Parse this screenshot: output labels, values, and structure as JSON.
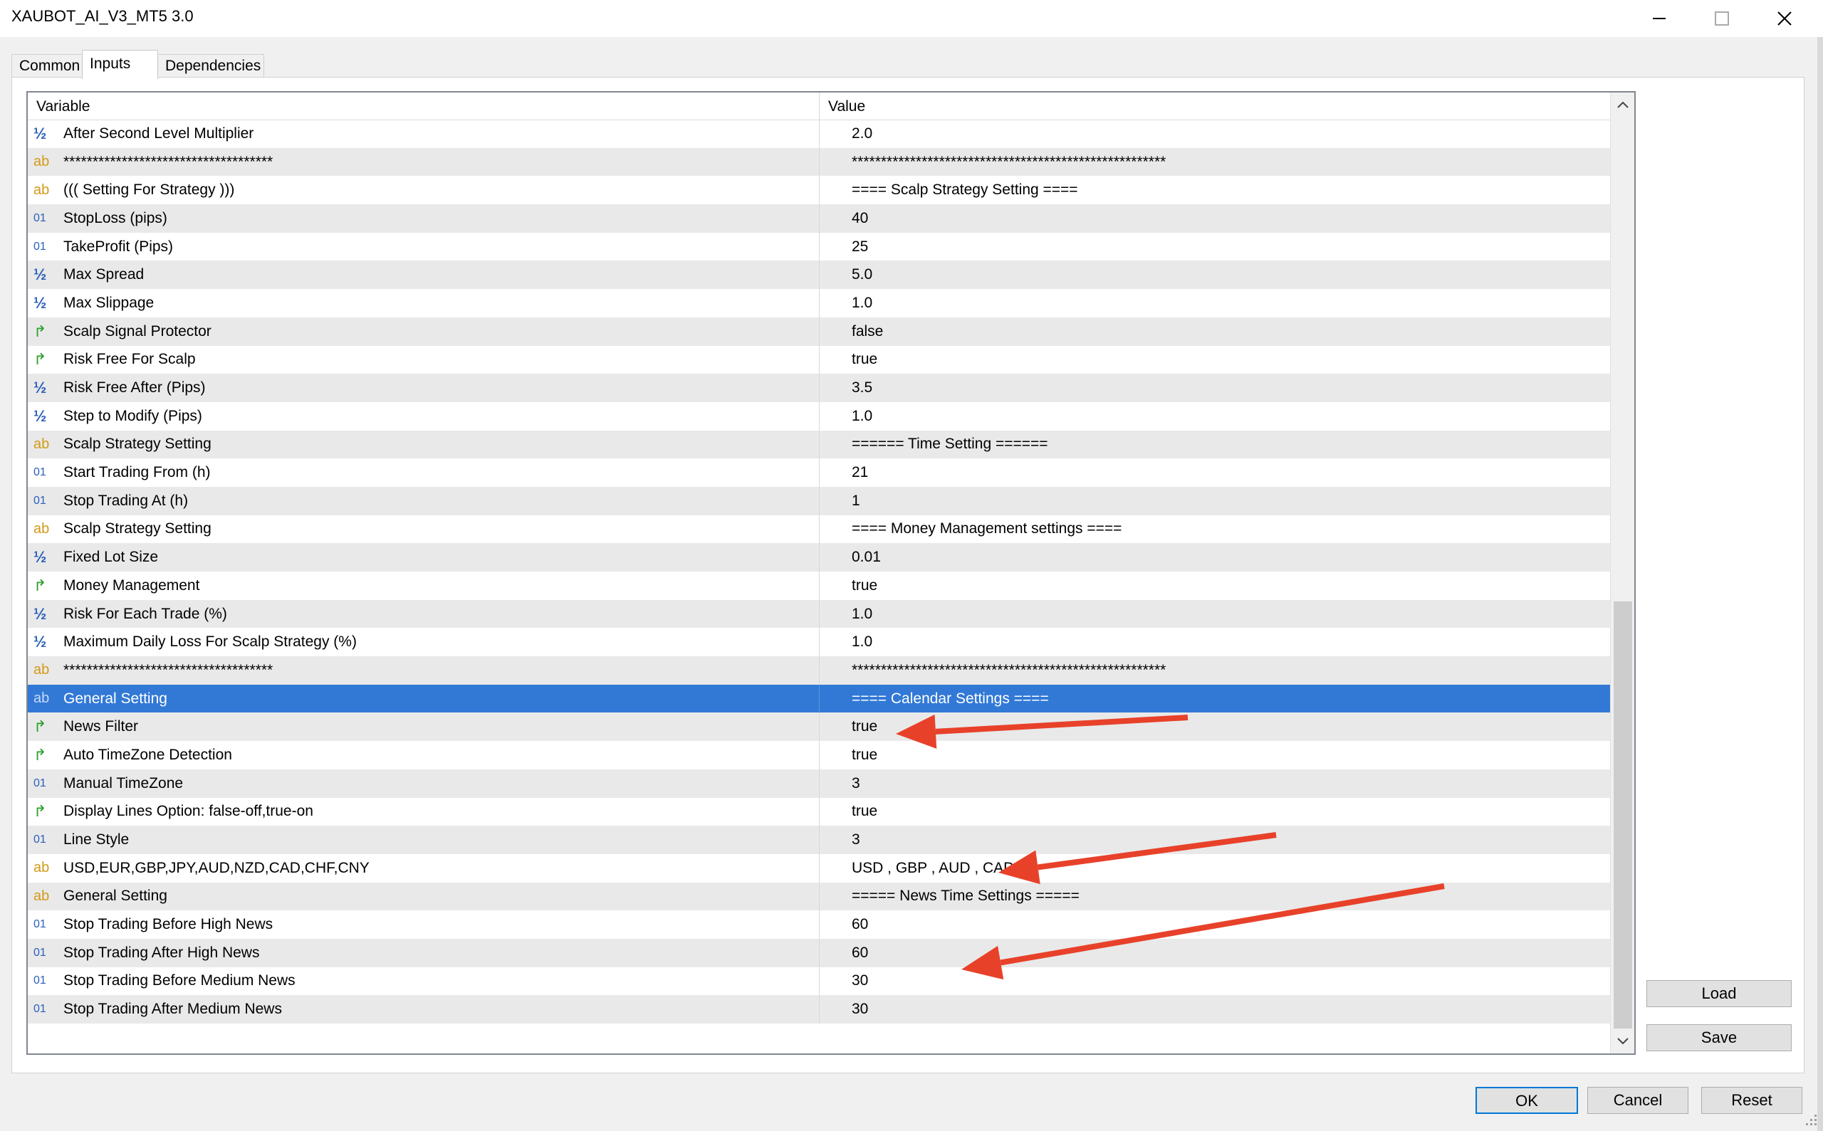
{
  "window": {
    "title": "XAUBOT_AI_V3_MT5 3.0",
    "icons": {
      "minimize": "minimize-icon",
      "maximize": "maximize-icon",
      "close": "close-icon"
    }
  },
  "tabs": [
    {
      "label": "Common",
      "active": false
    },
    {
      "label": "Inputs",
      "active": true
    },
    {
      "label": "Dependencies",
      "active": false
    }
  ],
  "table": {
    "headers": {
      "variable": "Variable",
      "value": "Value"
    },
    "icon_glyphs": {
      "double": "½",
      "int": "01",
      "string": "ab",
      "bool": "↱"
    },
    "rows": [
      {
        "icon": "double",
        "variable": "After Second Level Multiplier",
        "value": "2.0"
      },
      {
        "icon": "string",
        "variable": "************************************",
        "value": "******************************************************"
      },
      {
        "icon": "string",
        "variable": "((( Setting For Strategy )))",
        "value": "==== Scalp Strategy Setting ===="
      },
      {
        "icon": "int",
        "variable": "StopLoss (pips)",
        "value": "40"
      },
      {
        "icon": "int",
        "variable": "TakeProfit (Pips)",
        "value": "25"
      },
      {
        "icon": "double",
        "variable": "Max Spread",
        "value": "5.0"
      },
      {
        "icon": "double",
        "variable": "Max Slippage",
        "value": "1.0"
      },
      {
        "icon": "bool",
        "variable": "Scalp Signal Protector",
        "value": "false"
      },
      {
        "icon": "bool",
        "variable": "Risk Free For Scalp",
        "value": "true"
      },
      {
        "icon": "double",
        "variable": "Risk Free After (Pips)",
        "value": "3.5"
      },
      {
        "icon": "double",
        "variable": "Step to Modify (Pips)",
        "value": "1.0"
      },
      {
        "icon": "string",
        "variable": "Scalp Strategy Setting",
        "value": "====== Time Setting ======"
      },
      {
        "icon": "int",
        "variable": "Start Trading From (h)",
        "value": "21"
      },
      {
        "icon": "int",
        "variable": "Stop Trading At (h)",
        "value": "1"
      },
      {
        "icon": "string",
        "variable": "Scalp Strategy Setting",
        "value": "==== Money Management settings ===="
      },
      {
        "icon": "double",
        "variable": "Fixed Lot Size",
        "value": "0.01"
      },
      {
        "icon": "bool",
        "variable": "Money Management",
        "value": "true"
      },
      {
        "icon": "double",
        "variable": "Risk For Each Trade (%)",
        "value": "1.0"
      },
      {
        "icon": "double",
        "variable": "Maximum Daily Loss For Scalp Strategy (%)",
        "value": "1.0"
      },
      {
        "icon": "string",
        "variable": "************************************",
        "value": "******************************************************"
      },
      {
        "icon": "string",
        "variable": "General Setting",
        "value": "==== Calendar Settings ====",
        "selected": true
      },
      {
        "icon": "bool",
        "variable": "News Filter",
        "value": "true"
      },
      {
        "icon": "bool",
        "variable": "Auto TimeZone Detection",
        "value": "true"
      },
      {
        "icon": "int",
        "variable": "Manual TimeZone",
        "value": "3"
      },
      {
        "icon": "bool",
        "variable": "Display Lines Option: false-off,true-on",
        "value": "true"
      },
      {
        "icon": "int",
        "variable": "Line Style",
        "value": "3"
      },
      {
        "icon": "string",
        "variable": "USD,EUR,GBP,JPY,AUD,NZD,CAD,CHF,CNY",
        "value": "USD , GBP , AUD , CAD"
      },
      {
        "icon": "string",
        "variable": "General Setting",
        "value": "===== News Time Settings ====="
      },
      {
        "icon": "int",
        "variable": "Stop Trading Before High News",
        "value": "60"
      },
      {
        "icon": "int",
        "variable": "Stop Trading After High News",
        "value": "60"
      },
      {
        "icon": "int",
        "variable": "Stop Trading Before Medium News",
        "value": "30"
      },
      {
        "icon": "int",
        "variable": "Stop Trading After Medium News",
        "value": "30"
      }
    ]
  },
  "side_buttons": {
    "load": "Load",
    "save": "Save"
  },
  "bottom_buttons": {
    "ok": "OK",
    "cancel": "Cancel",
    "reset": "Reset"
  },
  "colors": {
    "selection": "#3279d6",
    "annotation_arrow": "#e8412a",
    "alt_row": "#e9e9e9"
  }
}
